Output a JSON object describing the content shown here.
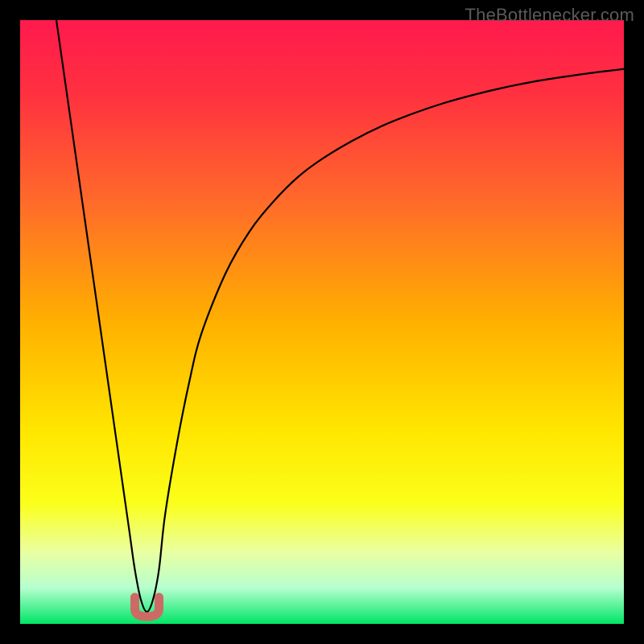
{
  "watermark": {
    "text": "TheBottlenecker.com"
  },
  "chart_data": {
    "type": "line",
    "title": "",
    "xlabel": "",
    "ylabel": "",
    "xlim": [
      0,
      100
    ],
    "ylim": [
      0,
      100
    ],
    "x": [
      6,
      8,
      10,
      12,
      14,
      16,
      18,
      19,
      20,
      21,
      22,
      23,
      24,
      26,
      28,
      30,
      34,
      38,
      42,
      46,
      50,
      55,
      60,
      65,
      70,
      75,
      80,
      85,
      90,
      95,
      100
    ],
    "values": [
      100,
      86,
      72,
      58,
      44,
      30,
      16,
      9,
      4,
      2,
      4,
      9,
      18,
      30,
      40,
      48,
      58,
      65,
      70,
      74,
      77,
      80,
      82.5,
      84.5,
      86.2,
      87.6,
      88.8,
      89.8,
      90.6,
      91.3,
      91.9
    ],
    "notch": {
      "x_center": 21,
      "y": 2,
      "width": 4,
      "color": "#cc6b66"
    },
    "gradient_stops": [
      {
        "pos": 0.0,
        "color": "#ff1a4d"
      },
      {
        "pos": 0.12,
        "color": "#ff3040"
      },
      {
        "pos": 0.3,
        "color": "#ff6a2a"
      },
      {
        "pos": 0.5,
        "color": "#ffb000"
      },
      {
        "pos": 0.68,
        "color": "#ffe600"
      },
      {
        "pos": 0.8,
        "color": "#fbff1a"
      },
      {
        "pos": 0.88,
        "color": "#eaffa0"
      },
      {
        "pos": 0.94,
        "color": "#b6ffce"
      },
      {
        "pos": 1.0,
        "color": "#00e566"
      }
    ]
  }
}
